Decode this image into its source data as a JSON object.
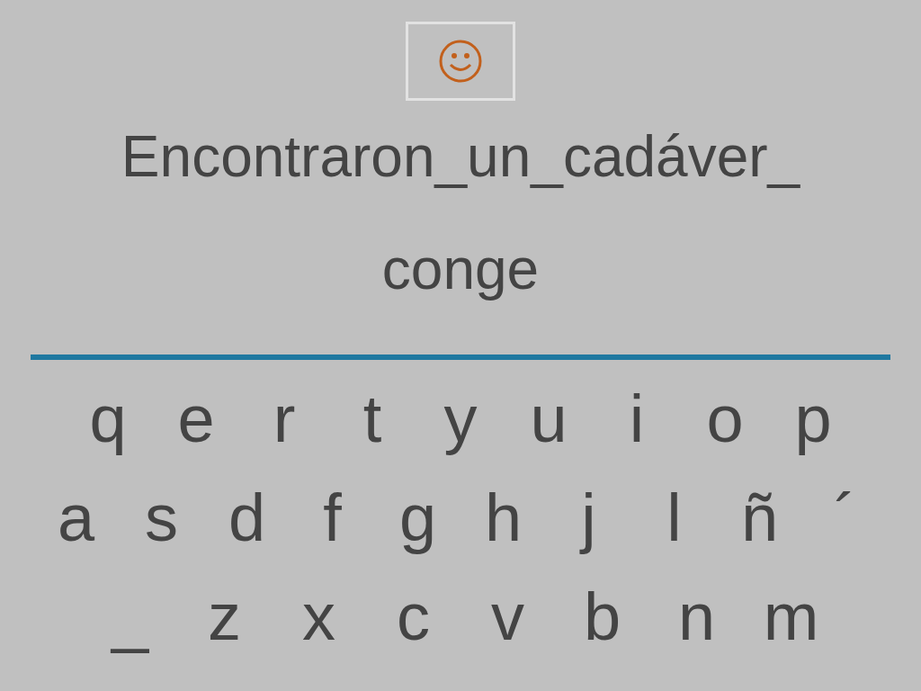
{
  "sentence_lines": [
    "Encontraron_un_cadáver_",
    "conge"
  ],
  "keyboard": {
    "rows": [
      [
        "q",
        "e",
        "r",
        "t",
        "y",
        "u",
        "i",
        "o",
        "p"
      ],
      [
        "a",
        "s",
        "d",
        "f",
        "g",
        "h",
        "j",
        "l",
        "ñ",
        "´"
      ],
      [
        "_",
        "z",
        "x",
        "c",
        "v",
        "b",
        "n",
        "m"
      ]
    ]
  }
}
